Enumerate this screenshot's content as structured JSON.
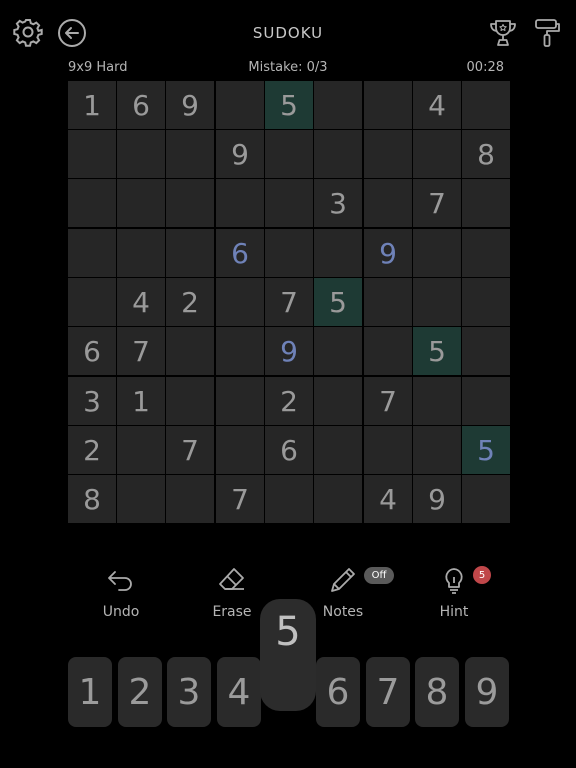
{
  "header": {
    "title": "SUDOKU"
  },
  "status": {
    "difficulty": "9x9 Hard",
    "mistakes": "Mistake: 0/3",
    "timer": "00:28"
  },
  "board": {
    "rows": [
      [
        "1",
        "6",
        "9",
        "",
        "5",
        "",
        "",
        "4",
        ""
      ],
      [
        "",
        "",
        "",
        "9",
        "",
        "",
        "",
        "",
        "8"
      ],
      [
        "",
        "",
        "",
        "",
        "",
        "3",
        "",
        "7",
        ""
      ],
      [
        "",
        "",
        "",
        "6",
        "",
        "",
        "9",
        "",
        ""
      ],
      [
        "",
        "4",
        "2",
        "",
        "7",
        "5",
        "",
        "",
        ""
      ],
      [
        "6",
        "7",
        "",
        "",
        "9",
        "",
        "",
        "5",
        ""
      ],
      [
        "3",
        "1",
        "",
        "",
        "2",
        "",
        "7",
        "",
        ""
      ],
      [
        "2",
        "",
        "7",
        "",
        "6",
        "",
        "",
        "",
        "5"
      ],
      [
        "8",
        "",
        "",
        "7",
        "",
        "",
        "4",
        "9",
        ""
      ]
    ]
  },
  "tools": {
    "undo": "Undo",
    "erase": "Erase",
    "notes": "Notes",
    "notes_state": "Off",
    "hint": "Hint",
    "hint_count": "5"
  },
  "numpad": [
    "1",
    "2",
    "3",
    "4",
    "5",
    "6",
    "7",
    "8",
    "9"
  ],
  "colors": {
    "highlight": "#1e3a34",
    "user_digit": "#6f82b8",
    "badge_red": "#c0474a",
    "badge_gray": "#555555"
  }
}
